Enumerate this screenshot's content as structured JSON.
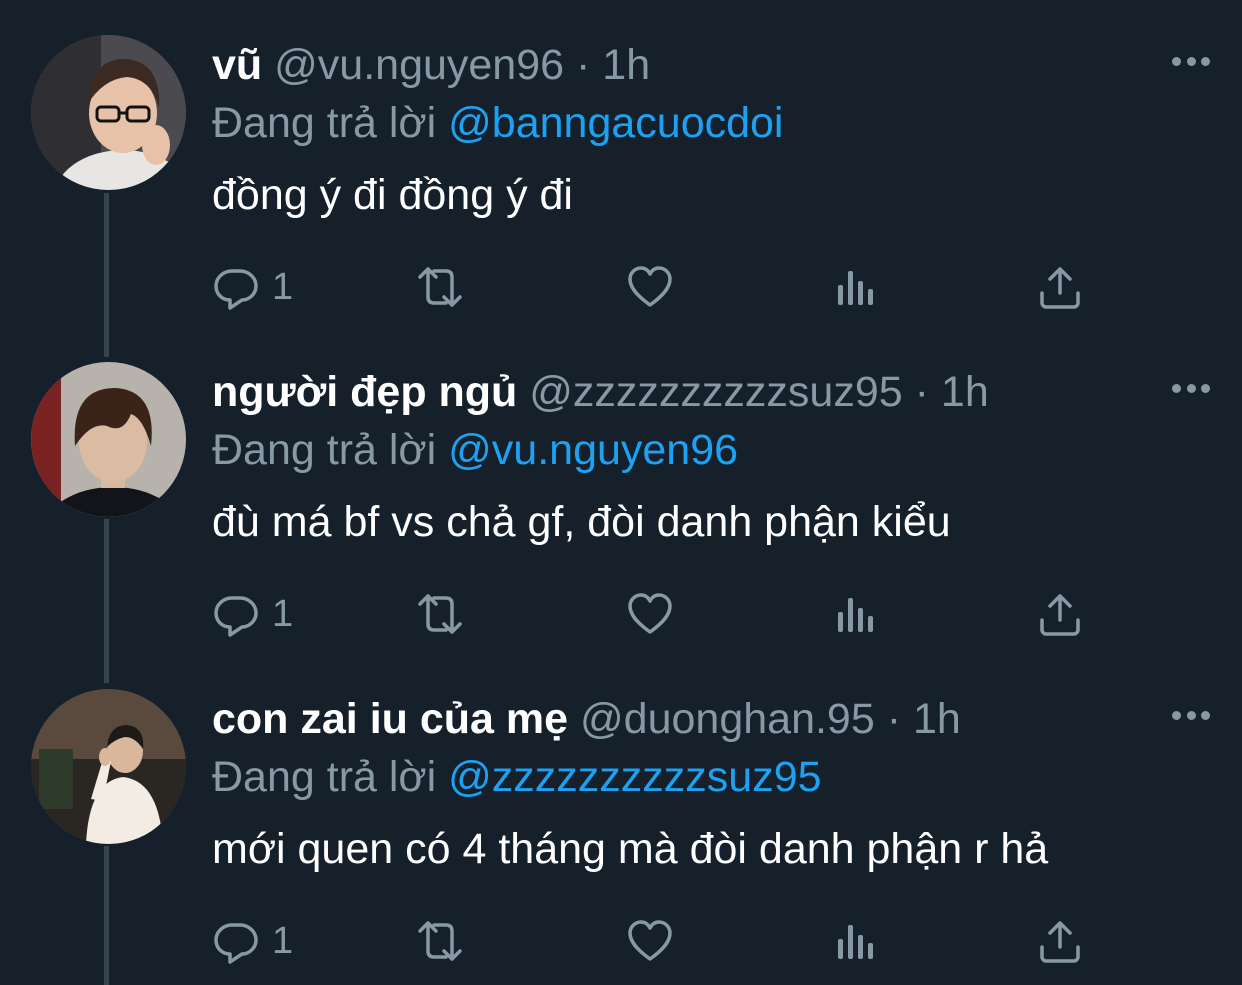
{
  "reply_prefix": "Đang trả lời",
  "tweets": [
    {
      "name": "vũ",
      "handle": "@vu.nguyen96",
      "separator": "·",
      "time": "1h",
      "reply_to": "@banngacuocdoi",
      "text": "đồng ý đi đồng ý đi",
      "reply_count": "1",
      "avatar_icon": "avatar-person-glasses"
    },
    {
      "name": "người đẹp ngủ",
      "handle": "@zzzzzzzzzzsuz95",
      "separator": "·",
      "time": "1h",
      "reply_to": "@vu.nguyen96",
      "text": "đù má bf vs chả gf, đòi danh phận kiểu",
      "reply_count": "1",
      "avatar_icon": "avatar-person"
    },
    {
      "name": "con zai iu của mẹ",
      "handle": "@duonghan.95",
      "separator": "·",
      "time": "1h",
      "reply_to": "@zzzzzzzzzzsuz95",
      "text": "mới quen có 4 tháng mà đòi danh phận r hả",
      "reply_count": "1",
      "avatar_icon": "avatar-person-hoodie"
    }
  ],
  "icons": {
    "reply": "reply-icon",
    "retweet": "retweet-icon",
    "like": "like-icon",
    "analytics": "analytics-icon",
    "share": "share-icon",
    "more": "more-icon"
  },
  "colors": {
    "background": "#15202b",
    "secondary_text": "#8899a6",
    "mention": "#1da1f2",
    "thread_line": "#38444d"
  }
}
